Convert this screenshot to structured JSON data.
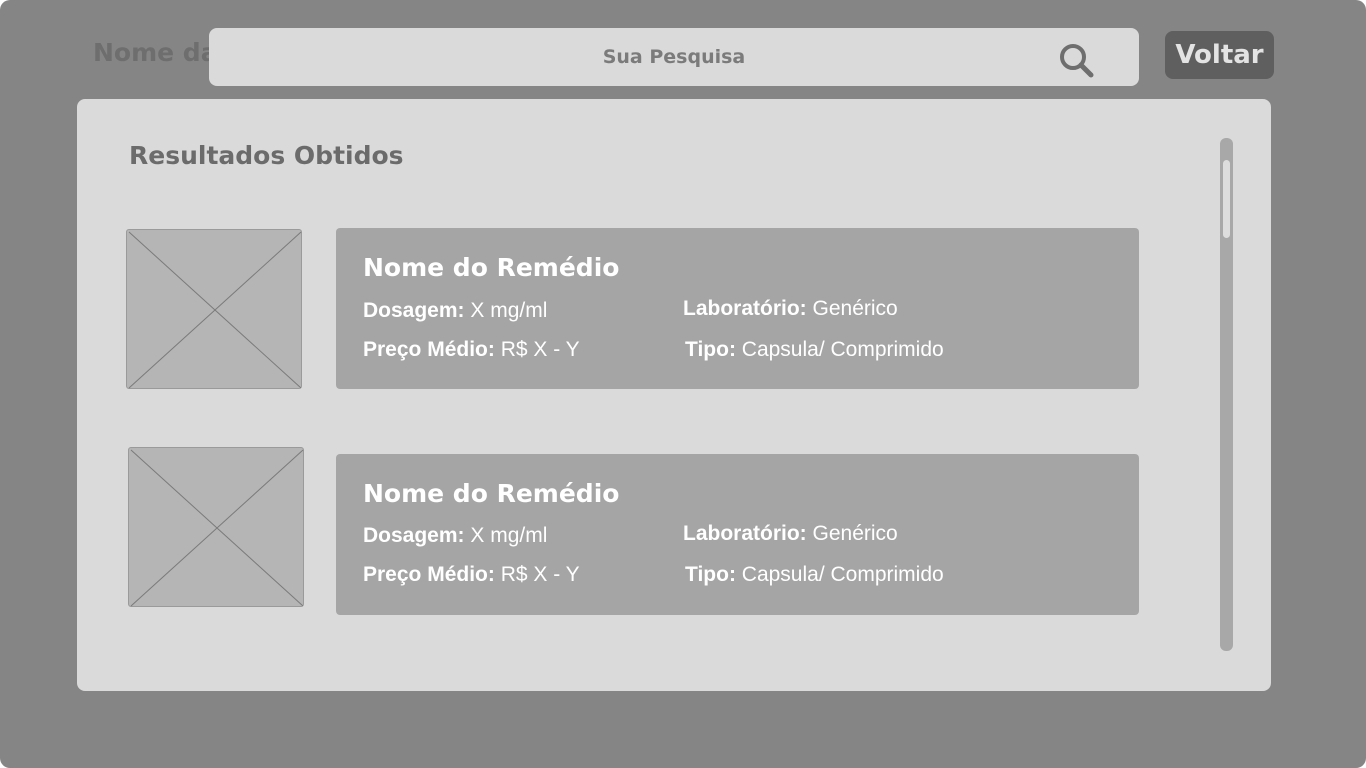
{
  "header": {
    "app_name": "Nome da",
    "search": {
      "placeholder": "Sua Pesquisa",
      "icon": "search-icon"
    },
    "back_label": "Voltar"
  },
  "results": {
    "title": "Resultados Obtidos",
    "items": [
      {
        "name": "Nome do Remédio",
        "dosage_label": "Dosagem:",
        "dosage_value": "X mg/ml",
        "price_label": "Preço Médio:",
        "price_value": "R$ X - Y",
        "lab_label": "Laboratório:",
        "lab_value": "Genérico",
        "type_label": "Tipo:",
        "type_value": "Capsula/ Comprimido"
      },
      {
        "name": "Nome do Remédio",
        "dosage_label": "Dosagem:",
        "dosage_value": "X mg/ml",
        "price_label": "Preço Médio:",
        "price_value": "R$ X - Y",
        "lab_label": "Laboratório:",
        "lab_value": "Genérico",
        "type_label": "Tipo:",
        "type_value": "Capsula/ Comprimido"
      }
    ]
  },
  "colors": {
    "background": "#858585",
    "panel": "#dadada",
    "card": "#a5a5a5",
    "button": "#5f5f5f"
  }
}
